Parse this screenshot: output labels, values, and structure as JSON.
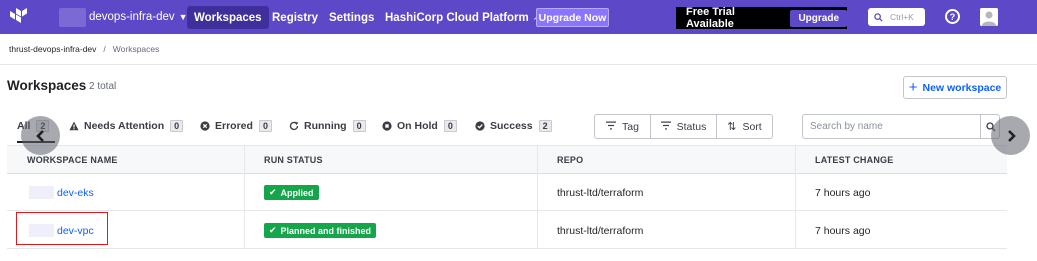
{
  "topnav": {
    "org_name": "devops-infra-dev",
    "items": [
      {
        "label": "Workspaces",
        "active": true
      },
      {
        "label": "Registry",
        "active": false
      },
      {
        "label": "Settings",
        "active": false
      },
      {
        "label": "HashiCorp Cloud Platform",
        "active": false,
        "external": true
      }
    ],
    "upgrade_now": "Upgrade Now",
    "trial_text": "Free Trial Available",
    "trial_upgrade": "Upgrade",
    "search_shortcut": "Ctrl+K",
    "help_icon": "?",
    "colors": {
      "nav_bg": "#5d49c7",
      "nav_active": "#3f2f9a",
      "trial_bg": "#000000"
    }
  },
  "breadcrumb": {
    "org": "thrust-devops-infra-dev",
    "separator": "/",
    "current": "Workspaces"
  },
  "header": {
    "title": "Workspaces",
    "total": "2 total",
    "new_button": "New workspace"
  },
  "filters": {
    "tabs": [
      {
        "label": "All",
        "count": "2",
        "icon": "list-icon"
      },
      {
        "label": "Needs Attention",
        "count": "0",
        "icon": "warning-triangle-icon"
      },
      {
        "label": "Errored",
        "count": "0",
        "icon": "x-circle-icon"
      },
      {
        "label": "Running",
        "count": "0",
        "icon": "refresh-icon"
      },
      {
        "label": "On Hold",
        "count": "0",
        "icon": "stop-circle-icon"
      },
      {
        "label": "Success",
        "count": "2",
        "icon": "check-circle-icon"
      }
    ],
    "tag": "Tag",
    "status": "Status",
    "sort": "Sort",
    "search_placeholder": "Search by name"
  },
  "table": {
    "columns": [
      "WORKSPACE NAME",
      "RUN STATUS",
      "REPO",
      "LATEST CHANGE"
    ],
    "rows": [
      {
        "name": "dev-eks",
        "status": "Applied",
        "repo": "thrust-ltd/terraform",
        "latest_change": "7 hours ago"
      },
      {
        "name": "dev-vpc",
        "status": "Planned and finished",
        "repo": "thrust-ltd/terraform",
        "latest_change": "7 hours ago"
      }
    ],
    "status_color": "#15a54a",
    "link_color": "#1060ff"
  }
}
